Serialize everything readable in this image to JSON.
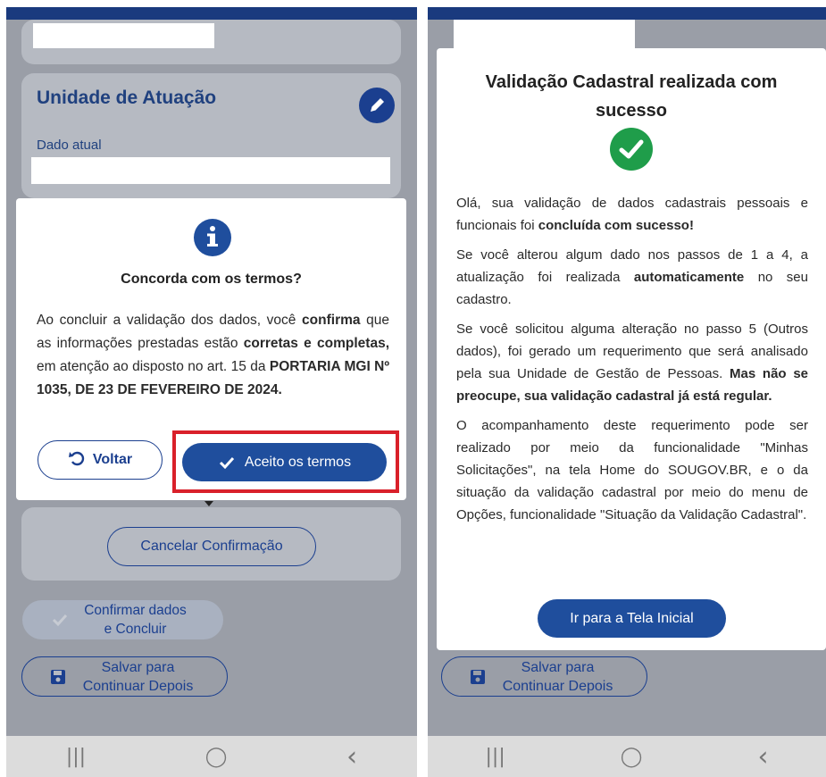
{
  "left": {
    "card_title": "Unidade de Atuação",
    "current_label": "Dado atual",
    "dialog": {
      "title": "Concorda com os termos?",
      "body_1": "Ao concluir a validação dos dados, você ",
      "body_bold_1": "confirma",
      "body_2": " que as informações prestadas estão ",
      "body_bold_2": "corretas e completas,",
      "body_3": " em atenção ao disposto no art. 15 da ",
      "body_bold_3": "PORTARIA MGI Nº 1035, DE 23 DE FEVEREIRO DE 2024.",
      "back_label": "Voltar",
      "accept_label": "Aceito os termos"
    },
    "cancel_label": "Cancelar Confirmação",
    "confirm_label_1": "Confirmar dados",
    "confirm_label_2": "e Concluir",
    "save_label_1": "Salvar para",
    "save_label_2": "Continuar Depois"
  },
  "right": {
    "dialog": {
      "title": "Validação Cadastral realizada com sucesso",
      "p1_a": "Olá, sua validação de dados cadastrais pessoais e funcionais foi ",
      "p1_b": "concluída com sucesso!",
      "p2_a": "Se você alterou algum dado nos passos de 1 a 4, a atualização foi realizada ",
      "p2_b": "automaticamente",
      "p2_c": " no seu cadastro.",
      "p3_a": "Se você solicitou alguma alteração no passo 5 (Outros dados), foi gerado um requerimento que será analisado pela sua Unidade de Gestão de Pessoas. ",
      "p3_b": "Mas não se preocupe, sua validação cadastral já está regular.",
      "p4": "O acompanhamento deste requerimento pode ser realizado por meio da funcionalidade \"Minhas Solicitações\", na tela Home do SOUGOV.BR, e o da situação da validação cadastral por meio do menu de Opções, funcionalidade \"Situação da Validação Cadastral\".",
      "home_button": "Ir para a Tela Inicial"
    },
    "save_label_1": "Salvar para",
    "save_label_2": "Continuar Depois"
  },
  "nav": {
    "recent": "|||",
    "home": "◯",
    "back": "‹"
  },
  "colors": {
    "primary": "#1f4e9d",
    "highlight": "#d9202a",
    "success": "#1f9d4a",
    "status_bar": "#1a3a7e"
  },
  "icons": {
    "edit": "pencil-icon",
    "info": "info-icon",
    "undo": "undo-icon",
    "check": "check-icon",
    "save": "save-icon",
    "success": "check-circle-icon"
  }
}
